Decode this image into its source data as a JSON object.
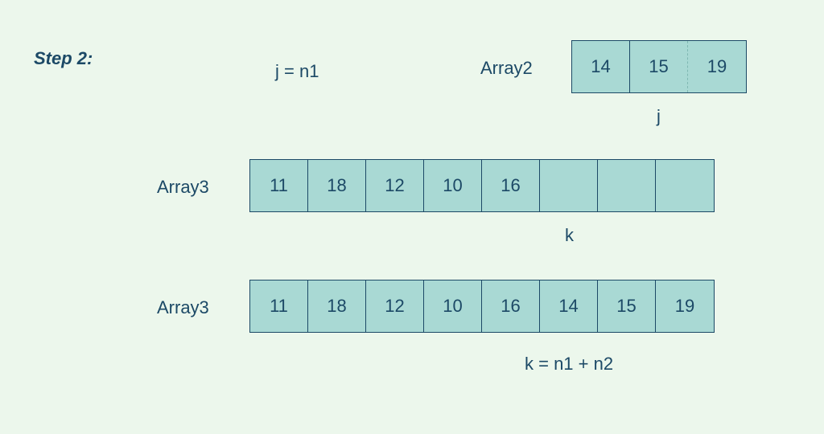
{
  "step_label": "Step 2:",
  "eq_j": "j = n1",
  "array2": {
    "label": "Array2",
    "cells": [
      "14",
      "15",
      "19"
    ],
    "pointer": "j"
  },
  "array3_a": {
    "label": "Array3",
    "cells": [
      "11",
      "18",
      "12",
      "10",
      "16",
      "",
      "",
      ""
    ],
    "pointer": "k"
  },
  "array3_b": {
    "label": "Array3",
    "cells": [
      "11",
      "18",
      "12",
      "10",
      "16",
      "14",
      "15",
      "19"
    ],
    "pointer": "k = n1 + n2"
  }
}
